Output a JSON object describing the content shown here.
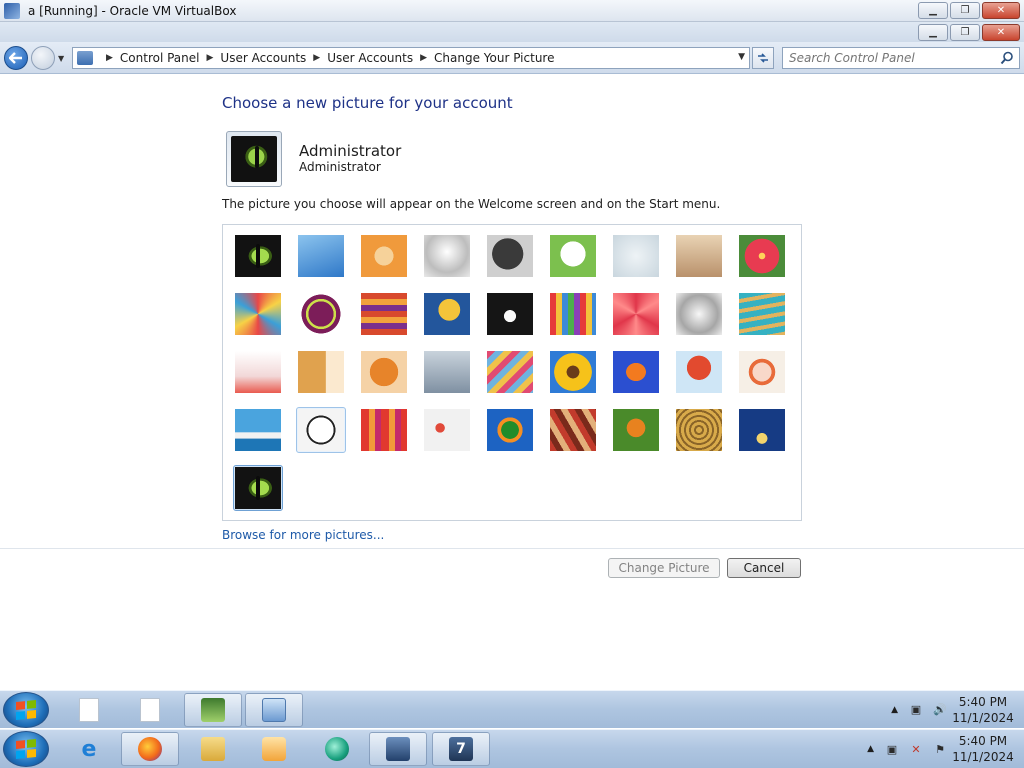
{
  "vbox": {
    "title": "a [Running] - Oracle VM VirtualBox",
    "btn_min": "▁",
    "btn_max": "❐",
    "btn_close": "✕"
  },
  "nav": {
    "breadcrumbs": [
      "Control Panel",
      "User Accounts",
      "User Accounts",
      "Change Your Picture"
    ],
    "search_placeholder": "Search Control Panel"
  },
  "content": {
    "heading": "Choose a new picture for your account",
    "account_name": "Administrator",
    "account_role": "Administrator",
    "description": "The picture you choose will appear on the Welcome screen and on the Start menu.",
    "browse_link": "Browse for more pictures...",
    "change_button": "Change Picture",
    "cancel_button": "Cancel"
  },
  "pictures": [
    {
      "name": "cat-eye"
    },
    {
      "name": "roller-coaster"
    },
    {
      "name": "starfish"
    },
    {
      "name": "robot"
    },
    {
      "name": "record-player"
    },
    {
      "name": "lucky-cat"
    },
    {
      "name": "gyroscope"
    },
    {
      "name": "kitten"
    },
    {
      "name": "flower"
    },
    {
      "name": "pinwheel"
    },
    {
      "name": "ball"
    },
    {
      "name": "fabric"
    },
    {
      "name": "leaf"
    },
    {
      "name": "dog"
    },
    {
      "name": "crayons"
    },
    {
      "name": "red-star"
    },
    {
      "name": "jacks"
    },
    {
      "name": "stairs"
    },
    {
      "name": "origami-crane"
    },
    {
      "name": "guitar"
    },
    {
      "name": "pomeranian"
    },
    {
      "name": "toy-robot"
    },
    {
      "name": "scarves"
    },
    {
      "name": "sunflower"
    },
    {
      "name": "fish"
    },
    {
      "name": "hot-air-balloon"
    },
    {
      "name": "ornament"
    },
    {
      "name": "sailboat"
    },
    {
      "name": "soccer-ball"
    },
    {
      "name": "striped-cloth"
    },
    {
      "name": "marbles"
    },
    {
      "name": "window"
    },
    {
      "name": "textile"
    },
    {
      "name": "butterfly"
    },
    {
      "name": "basket"
    },
    {
      "name": "lighthouse"
    },
    {
      "name": "cat-eye-custom"
    }
  ],
  "taskbar_inner": {
    "clock_time": "5:40 PM",
    "clock_date": "11/1/2024"
  },
  "taskbar_outer": {
    "clock_time": "5:40 PM",
    "clock_date": "11/1/2024"
  }
}
